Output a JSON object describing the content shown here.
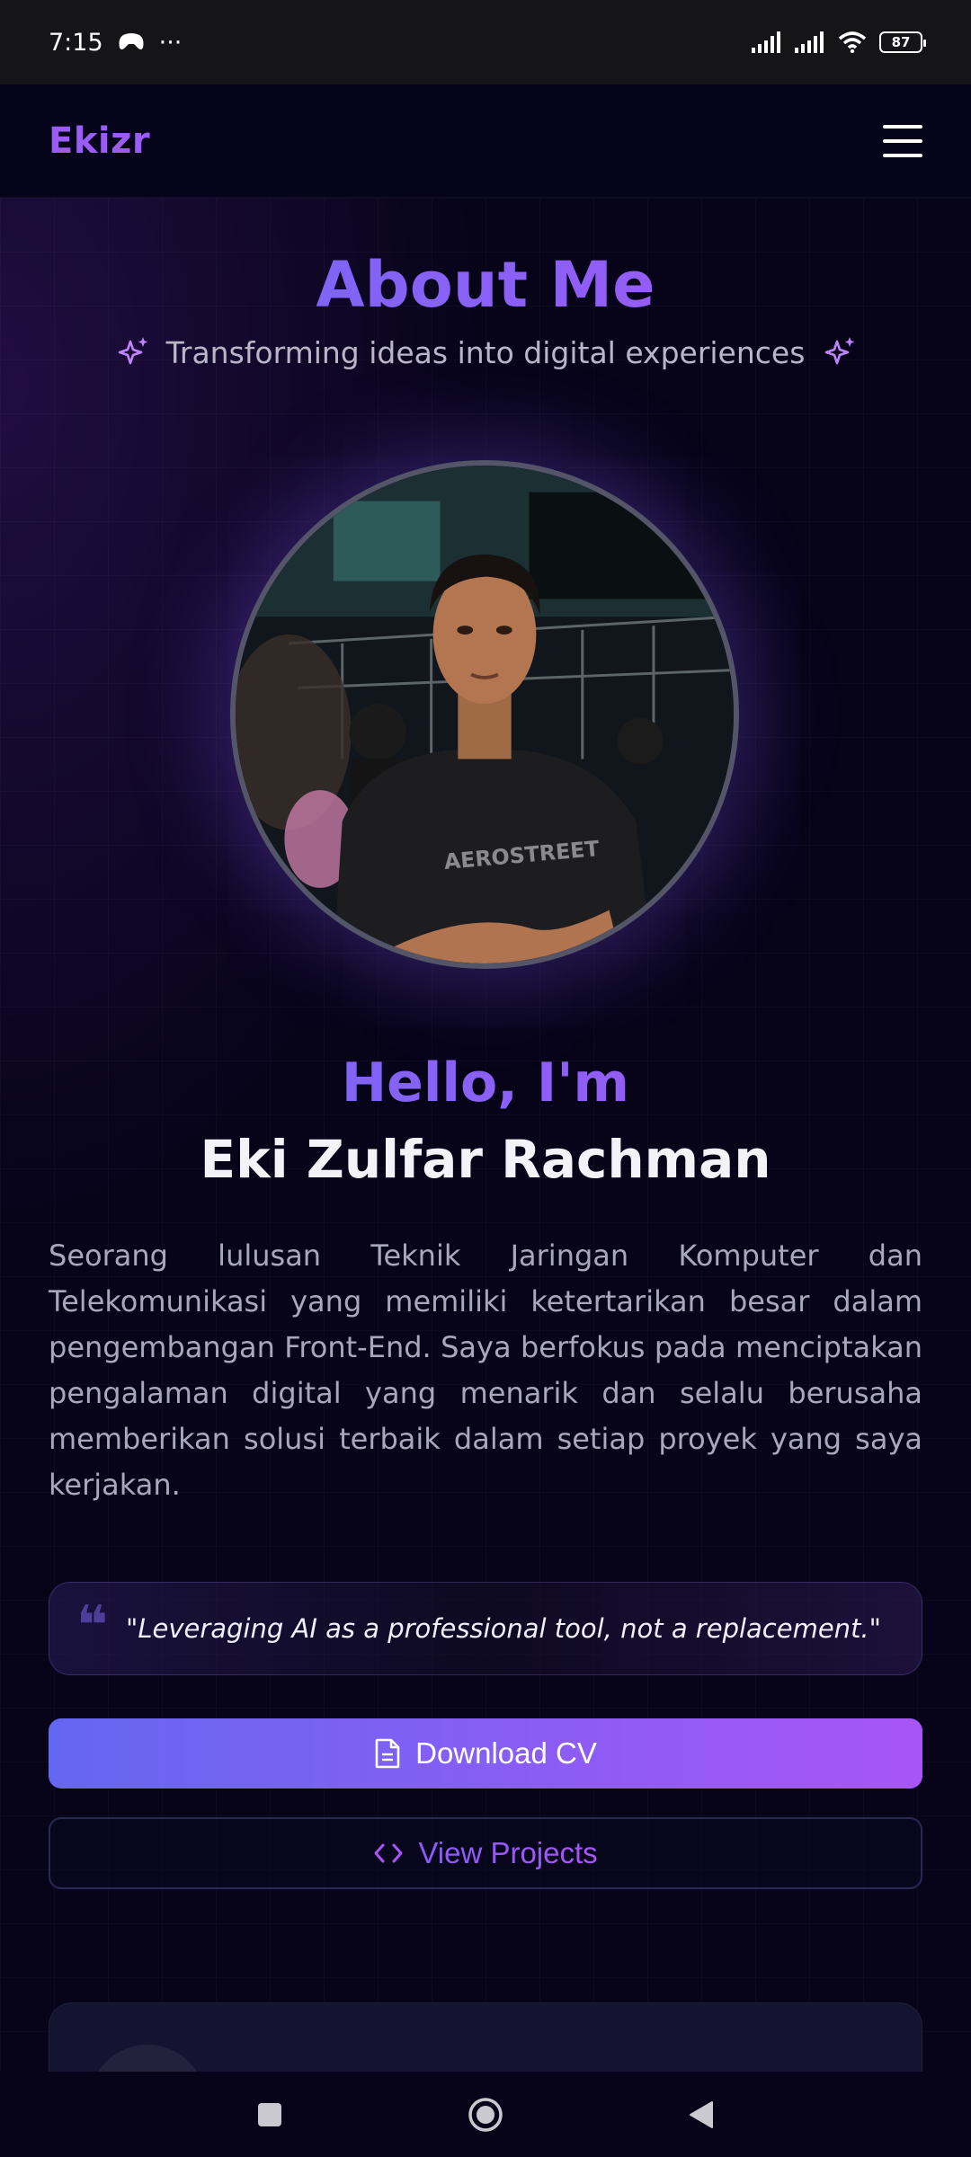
{
  "status_bar": {
    "time": "7:15",
    "extra": "···",
    "battery": "87",
    "icons": [
      "game-controller-icon",
      "signal-icon",
      "signal-icon",
      "wifi-icon",
      "battery-icon"
    ]
  },
  "header": {
    "brand": "Ekizr",
    "menu_icon": "hamburger-menu-icon"
  },
  "about": {
    "title": "About Me",
    "subtitle": "Transforming ideas into digital experiences",
    "sparkle_icon": "sparkle-icon"
  },
  "profile": {
    "greeting": "Hello, I'm",
    "name": "Eki Zulfar Rachman",
    "bio": "Seorang lulusan Teknik Jaringan Komputer dan Telekomunikasi yang memiliki ketertarikan besar dalam pengembangan Front-End. Saya berfokus pada menciptakan pengalaman digital yang menarik dan selalu berusaha memberikan solusi terbaik dalam setiap proyek yang saya kerjakan.",
    "photo_shirt_text": "AEROSTREET"
  },
  "quote": {
    "text": "\"Leveraging AI as a professional tool, not a replacement.\"",
    "icon": "quote-icon"
  },
  "buttons": {
    "download_cv": "Download CV",
    "download_icon": "document-icon",
    "view_projects": "View Projects",
    "code_icon": "code-icon"
  },
  "colors": {
    "accent_start": "#6467f2",
    "accent_end": "#a855f7",
    "background": "#07041a",
    "brand": "#9b5cf6"
  },
  "nav_bar": {
    "buttons": [
      "recents-square-icon",
      "home-circle-icon",
      "back-triangle-icon"
    ]
  }
}
